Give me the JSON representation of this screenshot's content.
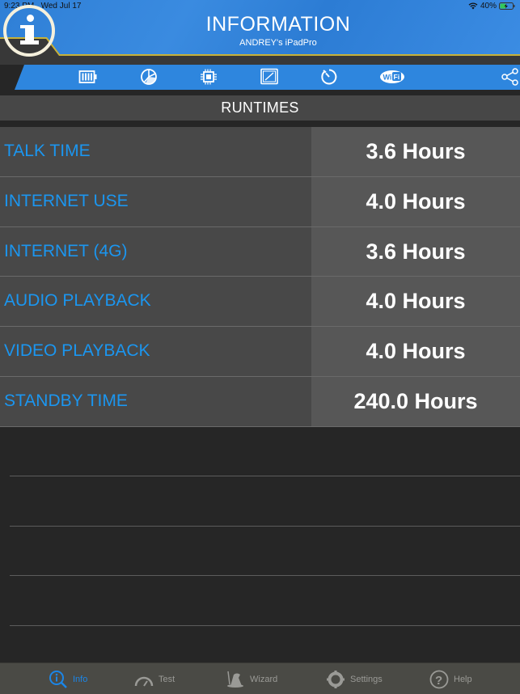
{
  "status_bar": {
    "time": "9:23 PM",
    "date": "Wed Jul 17",
    "battery_percent": "40%",
    "wifi_icon": "wifi-icon",
    "battery_icon": "battery-charging-icon"
  },
  "header": {
    "logo_icon": "info-icon",
    "title": "INFORMATION",
    "subtitle": "ANDREY's iPadPro"
  },
  "toolbar": {
    "items": [
      {
        "name": "battery",
        "icon": "battery-icon"
      },
      {
        "name": "storage",
        "icon": "pie-chart-icon"
      },
      {
        "name": "processor",
        "icon": "chip-icon"
      },
      {
        "name": "display",
        "icon": "screen-icon"
      },
      {
        "name": "timer",
        "icon": "stopwatch-icon"
      },
      {
        "name": "wifi",
        "icon": "wifi-logo-icon"
      },
      {
        "name": "share",
        "icon": "share-icon"
      }
    ]
  },
  "section": {
    "title": "RUNTIMES"
  },
  "runtimes": [
    {
      "label": "TALK TIME",
      "value": "3.6 Hours"
    },
    {
      "label": "INTERNET USE",
      "value": "4.0 Hours"
    },
    {
      "label": "INTERNET (4G)",
      "value": "3.6 Hours"
    },
    {
      "label": "AUDIO PLAYBACK",
      "value": "4.0 Hours"
    },
    {
      "label": "VIDEO PLAYBACK",
      "value": "4.0 Hours"
    },
    {
      "label": "STANDBY TIME",
      "value": "240.0 Hours"
    }
  ],
  "tabbar": {
    "active": "Info",
    "tabs": [
      {
        "label": "Info",
        "icon": "info-search-icon"
      },
      {
        "label": "Test",
        "icon": "speedometer-icon"
      },
      {
        "label": "Wizard",
        "icon": "wizard-hat-icon"
      },
      {
        "label": "Settings",
        "icon": "gear-icon"
      },
      {
        "label": "Help",
        "icon": "help-icon"
      }
    ]
  },
  "colors": {
    "accent_blue": "#2e86de",
    "label_blue": "#1b96f0",
    "gold_trim": "#c7b23a",
    "active_tab": "#1b86e8"
  }
}
